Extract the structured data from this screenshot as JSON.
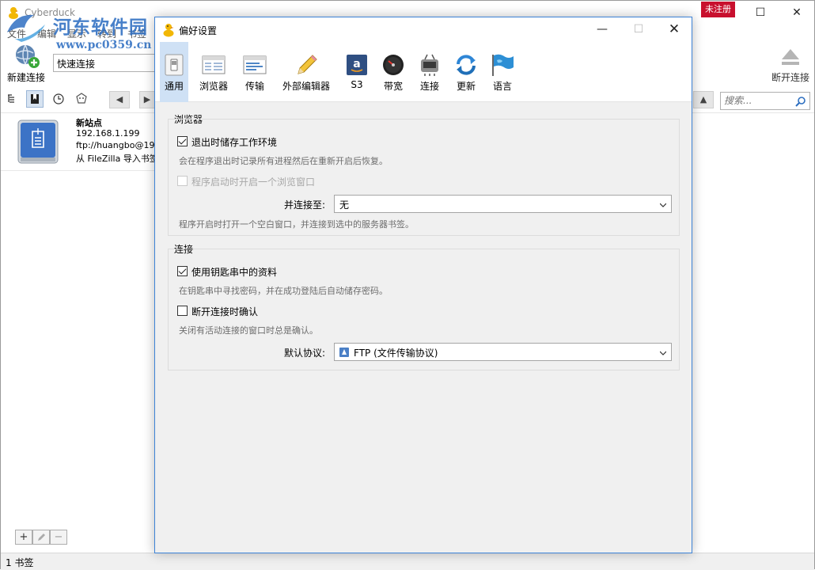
{
  "main": {
    "title": "Cyberduck",
    "unregistered": "未注册",
    "menu": [
      "文件",
      "编辑",
      "显示",
      "转到",
      "书签"
    ],
    "new_connection": "新建连接",
    "quick_connect": "快速连接",
    "disconnect": "断开连接",
    "search_placeholder": "搜索...",
    "bookmark": {
      "name": "新站点",
      "host": "192.168.1.199",
      "url": "ftp://huangbo@19",
      "note": "从 FileZilla 导入书签"
    },
    "status": "1 书签"
  },
  "watermark": {
    "name": "河东软件园",
    "url": "www.pc0359.cn"
  },
  "prefs": {
    "title": "偏好设置",
    "tabs": [
      {
        "label": "通用",
        "icon": "switch-icon"
      },
      {
        "label": "浏览器",
        "icon": "browser-window-icon"
      },
      {
        "label": "传输",
        "icon": "transfer-window-icon"
      },
      {
        "label": "外部编辑器",
        "icon": "pencil-icon"
      },
      {
        "label": "S3",
        "icon": "amazon-s3-icon"
      },
      {
        "label": "带宽",
        "icon": "speedometer-icon"
      },
      {
        "label": "连接",
        "icon": "network-icon"
      },
      {
        "label": "更新",
        "icon": "refresh-icon"
      },
      {
        "label": "语言",
        "icon": "flag-icon"
      }
    ],
    "browser_group": {
      "title": "浏览器",
      "save_workspace": "退出时储存工作环境",
      "save_workspace_hint": "会在程序退出时记录所有进程然后在重新开启后恢复。",
      "open_browser": "程序启动时开启一个浏览窗口",
      "connect_to_label": "并连接至:",
      "connect_to_value": "无",
      "connect_to_hint": "程序开启时打开一个空白窗口，并连接到选中的服务器书签。"
    },
    "connection_group": {
      "title": "连接",
      "use_keychain": "使用钥匙串中的资料",
      "use_keychain_hint": "在钥匙串中寻找密码，并在成功登陆后自动储存密码。",
      "confirm_disconnect": "断开连接时确认",
      "confirm_disconnect_hint": "关闭有活动连接的窗口时总是确认。",
      "protocol_label": "默认协议:",
      "protocol_value": "FTP (文件传输协议)"
    }
  }
}
